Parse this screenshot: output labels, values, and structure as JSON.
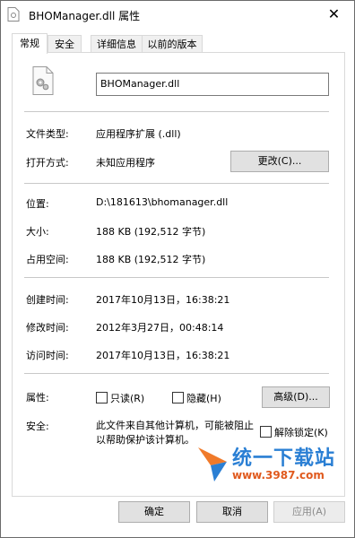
{
  "window": {
    "title": "BHOManager.dll 属性",
    "close_glyph": "✕"
  },
  "tabs": [
    {
      "label": "常规",
      "active": true
    },
    {
      "label": "安全",
      "active": false
    },
    {
      "label": "详细信息",
      "active": false
    },
    {
      "label": "以前的版本",
      "active": false
    }
  ],
  "general": {
    "file_name": "BHOManager.dll",
    "file_type_label": "文件类型:",
    "file_type_value": "应用程序扩展 (.dll)",
    "opens_with_label": "打开方式:",
    "opens_with_value": "未知应用程序",
    "change_button": "更改(C)...",
    "location_label": "位置:",
    "location_value": "D:\\181613\\bhomanager.dll",
    "size_label": "大小:",
    "size_value": "188 KB (192,512 字节)",
    "disk_size_label": "占用空间:",
    "disk_size_value": "188 KB (192,512 字节)",
    "created_label": "创建时间:",
    "created_value": "2017年10月13日，16:38:21",
    "modified_label": "修改时间:",
    "modified_value": "2012年3月27日，00:48:14",
    "accessed_label": "访问时间:",
    "accessed_value": "2017年10月13日，16:38:21",
    "attributes_label": "属性:",
    "readonly_label": "只读(R)",
    "hidden_label": "隐藏(H)",
    "advanced_button": "高级(D)...",
    "security_label": "安全:",
    "security_text": "此文件来自其他计算机，可能被阻止以帮助保护该计算机。",
    "unblock_label": "解除锁定(K)"
  },
  "footer": {
    "ok": "确定",
    "cancel": "取消",
    "apply": "应用(A)"
  },
  "watermark": {
    "text": "统一下载站",
    "url": "www.3987.com"
  },
  "colors": {
    "watermark_blue": "#2a7fd4",
    "watermark_orange": "#e05a1e"
  }
}
